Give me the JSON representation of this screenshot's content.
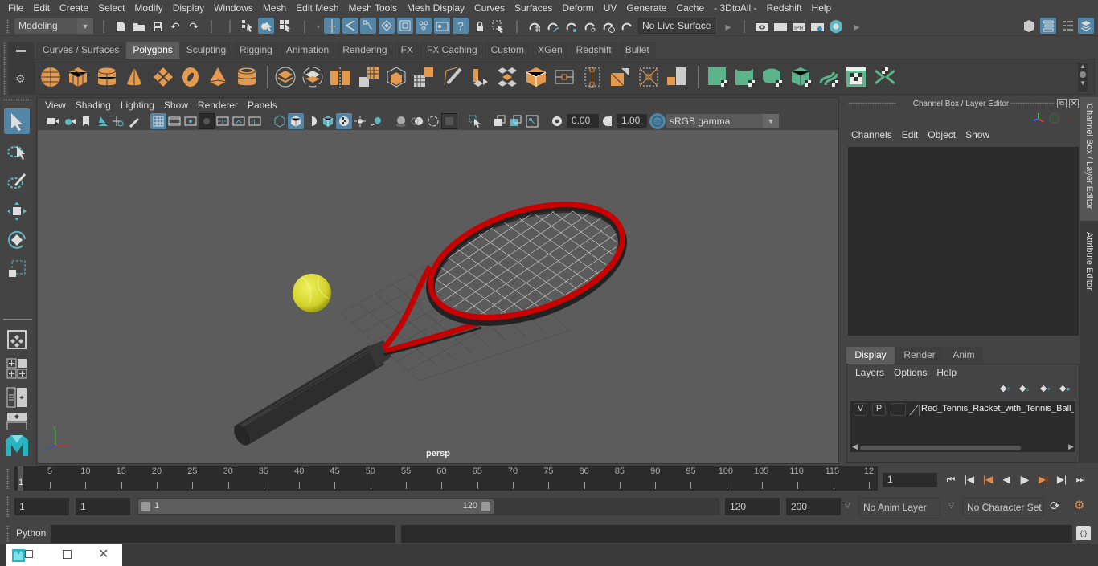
{
  "menubar": [
    "File",
    "Edit",
    "Create",
    "Select",
    "Modify",
    "Display",
    "Windows",
    "Mesh",
    "Edit Mesh",
    "Mesh Tools",
    "Mesh Display",
    "Curves",
    "Surfaces",
    "Deform",
    "UV",
    "Generate",
    "Cache",
    "- 3DtoAll -",
    "Redshift",
    "Help"
  ],
  "status": {
    "mode": "Modeling",
    "live_surface": "No Live Surface"
  },
  "shelf": {
    "tabs": [
      "Curves / Surfaces",
      "Polygons",
      "Sculpting",
      "Rigging",
      "Animation",
      "Rendering",
      "FX",
      "FX Caching",
      "Custom",
      "XGen",
      "Redshift",
      "Bullet"
    ],
    "active_tab": "Polygons"
  },
  "viewport": {
    "menu": [
      "View",
      "Shading",
      "Lighting",
      "Show",
      "Renderer",
      "Panels"
    ],
    "exposure": "0.00",
    "gamma": "1.00",
    "color_space": "sRGB gamma",
    "camera_label": "persp"
  },
  "channel_box": {
    "title": "Channel Box / Layer Editor",
    "menu": [
      "Channels",
      "Edit",
      "Object",
      "Show"
    ],
    "layer_tabs": [
      "Display",
      "Render",
      "Anim"
    ],
    "active_layer_tab": "Display",
    "layer_menu": [
      "Layers",
      "Options",
      "Help"
    ],
    "layers": [
      {
        "v": "V",
        "p": "P",
        "name": "Red_Tennis_Racket_with_Tennis_Ball_"
      }
    ]
  },
  "side_tabs": [
    "Channel Box / Layer Editor",
    "Attribute Editor"
  ],
  "timeline": {
    "ticks": [
      "5",
      "10",
      "15",
      "20",
      "25",
      "30",
      "35",
      "40",
      "45",
      "50",
      "55",
      "60",
      "65",
      "70",
      "75",
      "80",
      "85",
      "90",
      "95",
      "100",
      "105",
      "110",
      "115",
      "12"
    ],
    "current_frame_marker": "1",
    "current_frame": "1"
  },
  "range": {
    "start": "1",
    "playback_start": "1",
    "slider_start": "1",
    "slider_end": "120",
    "playback_end": "120",
    "end": "200",
    "anim_layer": "No Anim Layer",
    "character_set": "No Character Set"
  },
  "command": {
    "language": "Python"
  }
}
